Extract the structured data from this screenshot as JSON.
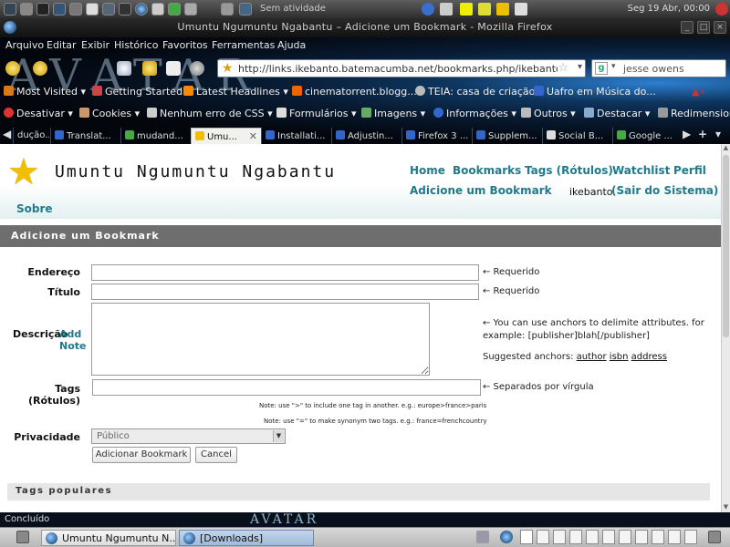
{
  "top_panel": {
    "status": "Sem atividade",
    "clock": "Seg 19 Abr, 00:00"
  },
  "window": {
    "title": "Umuntu Ngumuntu Ngabantu – Adicione um Bookmark - Mozilla Firefox"
  },
  "menu": {
    "items": [
      "Arquivo",
      "Editar",
      "Exibir",
      "Histórico",
      "Favoritos",
      "Ferramentas",
      "Ajuda"
    ]
  },
  "theme": {
    "logo_text": "AVATAR"
  },
  "navbar": {
    "url": "http://links.ikebanto.batemacumba.net/bookmarks.php/ikebanto?action=add",
    "search_value": "jesse owens"
  },
  "bookmarks_toolbar": {
    "items": [
      "Most Visited",
      "Getting Started",
      "Latest Headlines",
      "cinematorrent.blogg...",
      "TEIA: casa de criação",
      "Uafro em Música do..."
    ]
  },
  "webdev_toolbar": {
    "items": [
      "Desativar",
      "Cookies",
      "Nenhum erro de CSS",
      "Formulários",
      "Imagens",
      "Informações",
      "Outros",
      "Destacar",
      "Redimensionar"
    ]
  },
  "tabs": {
    "items": [
      "dução...",
      "Translat...",
      "mudand...",
      "Umu...",
      "Installati...",
      "Adjustin...",
      "Firefox 3 ...",
      "Supplem...",
      "Social B...",
      "Google ..."
    ],
    "new_tab": "+"
  },
  "site": {
    "title": "Umuntu Ngumuntu Ngabantu",
    "nav": {
      "home": "Home",
      "bookmarks": "Bookmarks",
      "tags": "Tags (Rótulos)",
      "watchlist": "Watchlist",
      "profile": "Perfil",
      "add_bookmark": "Adicione um Bookmark",
      "user": "ikebanto",
      "logout": "(Sair do Sistema)",
      "about": "Sobre"
    },
    "heading": "Adicione um Bookmark"
  },
  "form": {
    "address_label": "Endereço",
    "address_value": "",
    "address_note": "← Requerido",
    "title_label": "Título",
    "title_value": "",
    "title_note": "← Requerido",
    "description_label": "Descrição",
    "add_note": "Add Note",
    "description_note": "← You can use anchors to delimite attributes. for example: [publisher]blah[/publisher]",
    "suggested_anchors_label": "Suggested anchors:",
    "anchors": [
      "author",
      "isbn",
      "address"
    ],
    "tags_label": "Tags (Rótulos)",
    "tags_note": "← Separados por vírgula",
    "tags_hint_1": "Note: use \">\" to include one tag in another. e.g.: europe>france>paris",
    "tags_hint_2": "Note: use \"=\" to make synonym two tags. e.g.: france=frenchcountry",
    "privacy_label": "Privacidade",
    "privacy_value": "Público",
    "submit_label": "Adicionar Bookmark",
    "cancel_label": "Cancel",
    "popular_tags": "Tags populares"
  },
  "statusbar": {
    "status": "Concluído",
    "logo_text": "AVATAR"
  },
  "taskbar": {
    "items": [
      "Umuntu Ngumuntu N...",
      "[Downloads]"
    ]
  }
}
